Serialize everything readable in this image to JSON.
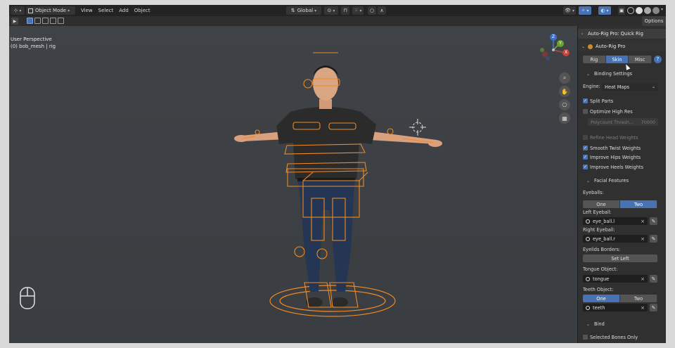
{
  "header": {
    "mode_label": "Object Mode",
    "menus": [
      "View",
      "Select",
      "Add",
      "Object"
    ],
    "orientation_label": "Global",
    "options_label": "Options"
  },
  "viewport": {
    "perspective_label": "User Perspective",
    "object_label": "(0) bob_mesh | rig"
  },
  "gizmo": {
    "axis_x": "X",
    "axis_y": "Y",
    "axis_z": "Z"
  },
  "sidebar": {
    "quick_rig_title": "Auto-Rig Pro: Quick Rig",
    "panel_title": "Auto-Rig Pro",
    "tabs": [
      "Rig",
      "Skin",
      "Misc"
    ],
    "active_tab": "Skin",
    "binding_settings": "Binding Settings",
    "engine_label": "Engine:",
    "engine_value": "Heat Maps",
    "split_parts": "Split Parts",
    "optimize_high_res": "Optimize High Res",
    "polycount_label": "Polycount Thresh...",
    "polycount_value": "70000",
    "refine_head_weights": "Refine Head Weights",
    "smooth_twist_weights": "Smooth Twist Weights",
    "improve_hips_weights": "Improve Hips Weights",
    "improve_heels_weights": "Improve Heels Weights",
    "facial_features": "Facial Features",
    "eyeballs_label": "Eyeballs:",
    "eyeballs_options": [
      "One",
      "Two"
    ],
    "left_eyeball_label": "Left Eyeball:",
    "left_eyeball_value": "eye_ball.l",
    "right_eyeball_label": "Right Eyeball:",
    "right_eyeball_value": "eye_ball.r",
    "eyelids_borders_label": "Eyelids Borders:",
    "set_left_label": "Set Left",
    "tongue_label": "Tongue Object:",
    "tongue_value": "tongue",
    "teeth_label": "Teeth Object:",
    "teeth_options": [
      "One",
      "Two"
    ],
    "teeth_value": "teeth",
    "bind_label": "Bind",
    "selected_bones_only": "Selected Bones Only"
  },
  "colors": {
    "accent": "#4772b3",
    "rig_orange": "#f08a24",
    "background": "#3e4145"
  }
}
